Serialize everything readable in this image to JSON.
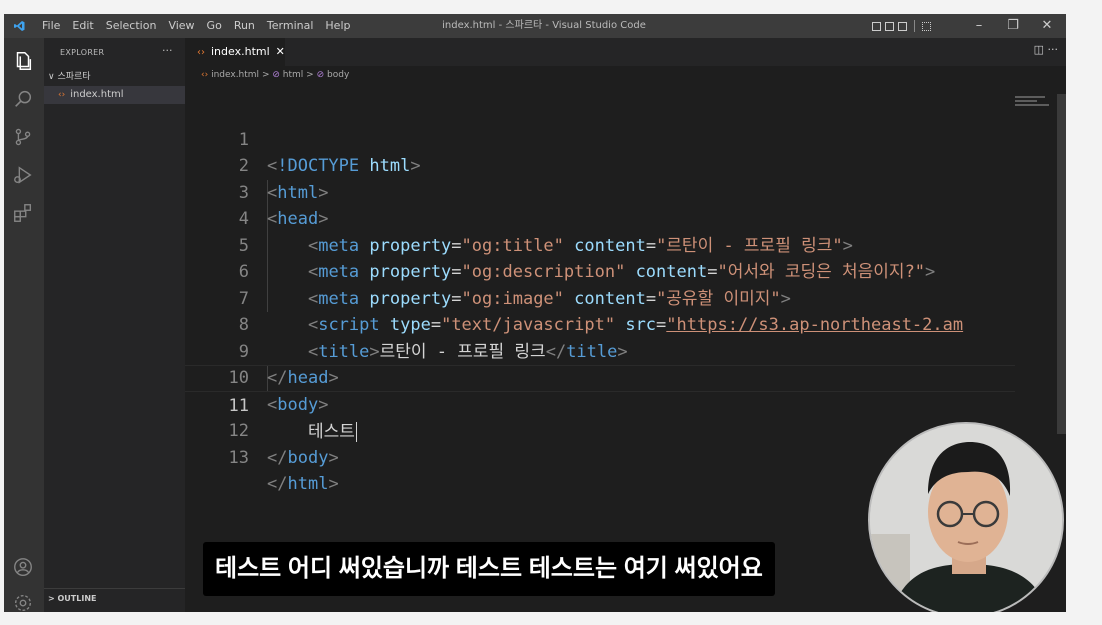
{
  "window": {
    "title": "index.html - 스파르타 - Visual Studio Code",
    "controls": [
      "–",
      "❐",
      "✕"
    ]
  },
  "menu": [
    "File",
    "Edit",
    "Selection",
    "View",
    "Go",
    "Run",
    "Terminal",
    "Help"
  ],
  "sidebar": {
    "title": "EXPLORER",
    "more": "···",
    "folder": "스파르타",
    "files": [
      {
        "name": "index.html"
      }
    ],
    "outline": "OUTLINE"
  },
  "tab": {
    "label": "index.html",
    "close": "✕"
  },
  "editor_actions": "◫ ···",
  "breadcrumb": {
    "file": "index.html",
    "sep1": ">",
    "item1": "html",
    "sep2": ">",
    "item2": "body"
  },
  "code": {
    "active_line": 11,
    "lines": [
      {
        "n": "1"
      },
      {
        "n": "2"
      },
      {
        "n": "3"
      },
      {
        "n": "4"
      },
      {
        "n": "5"
      },
      {
        "n": "6"
      },
      {
        "n": "7"
      },
      {
        "n": "8"
      },
      {
        "n": "9"
      },
      {
        "n": "10"
      },
      {
        "n": "11"
      },
      {
        "n": "12"
      },
      {
        "n": "13"
      }
    ],
    "tokens": {
      "doctype": "!DOCTYPE",
      "html": "html",
      "head": "head",
      "meta": "meta",
      "script": "script",
      "title": "title",
      "body": "body",
      "property": "property",
      "content": "content",
      "type": "type",
      "src": "src",
      "og_title": "\"og:title\"",
      "og_title_content": "\"르탄이 - 프로필 링크\"",
      "og_desc": "\"og:description\"",
      "og_desc_content": "\"어서와 코딩은 처음이지?\"",
      "og_image": "\"og:image\"",
      "og_image_content": "\"공유할 이미지\"",
      "script_type": "\"text/javascript\"",
      "script_src": "\"https://s3.ap-northeast-2.am",
      "title_text": "르탄이 - 프로필 링크",
      "body_text": "테스트"
    }
  },
  "subtitle": "테스트 어디 써있습니까 테스트 테스트는 여기 써있어요"
}
